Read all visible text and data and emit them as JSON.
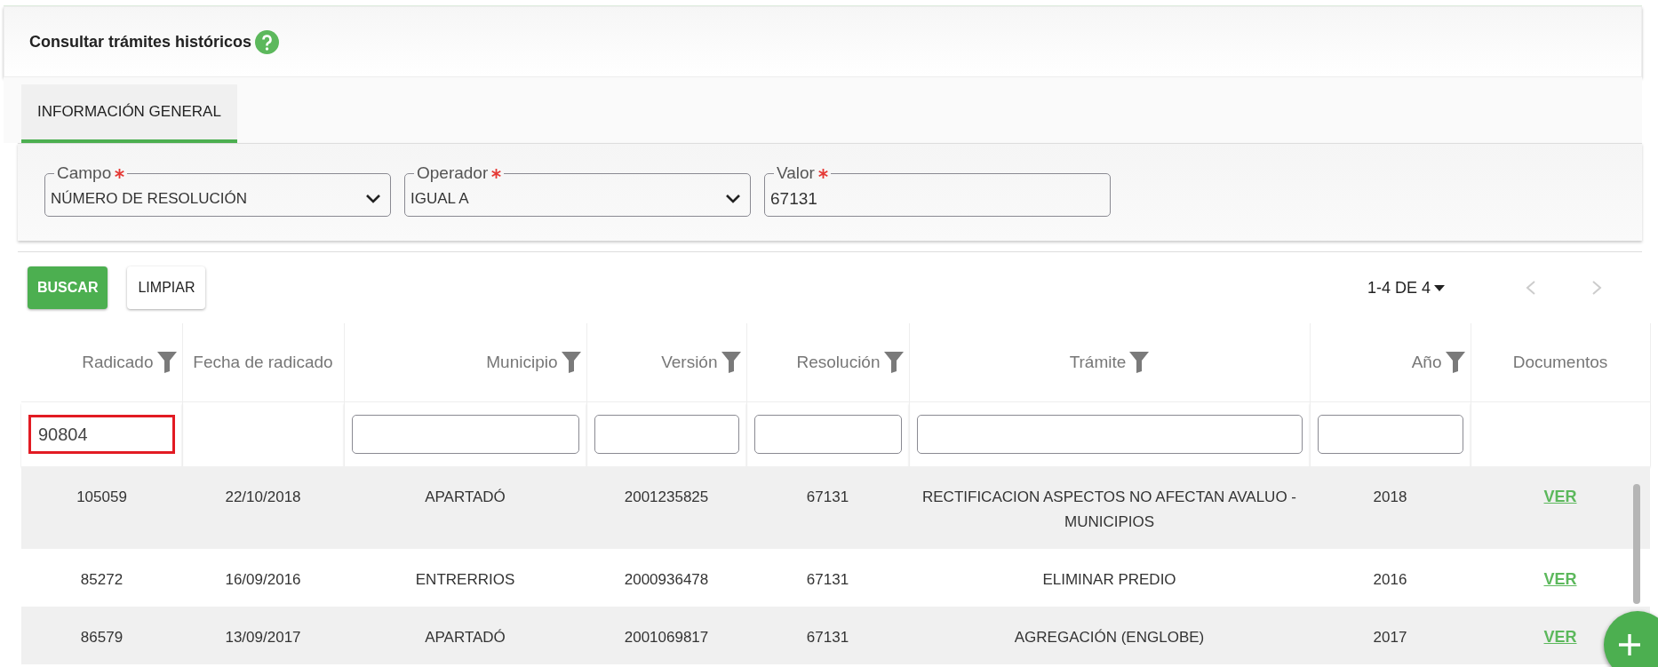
{
  "header": {
    "title": "Consultar trámites históricos"
  },
  "tabs": [
    {
      "label": "INFORMACIÓN GENERAL",
      "selected": true
    }
  ],
  "fields": [
    {
      "kind": "select",
      "label": "Campo",
      "required": true,
      "value": "NÚMERO DE RESOLUCIÓN"
    },
    {
      "kind": "select",
      "label": "Operador",
      "required": true,
      "value": "IGUAL A"
    },
    {
      "kind": "text",
      "label": "Valor",
      "required": true,
      "value": "67131"
    }
  ],
  "buttons": [
    {
      "label": "BUSCAR",
      "kind": "primary"
    },
    {
      "label": "LIMPIAR",
      "kind": "secondary"
    }
  ],
  "pagination": {
    "range": "1-4 DE 4",
    "prev_disabled": true,
    "next_disabled": true
  },
  "table": {
    "columns": [
      {
        "label": "Radicado",
        "filterable": true
      },
      {
        "label": "Fecha de radicado",
        "filterable": false
      },
      {
        "label": "Municipio",
        "filterable": true
      },
      {
        "label": "Versión",
        "filterable": true
      },
      {
        "label": "Resolución",
        "filterable": true
      },
      {
        "label": "Trámite",
        "filterable": true
      },
      {
        "label": "Año",
        "filterable": true
      },
      {
        "label": "Documentos",
        "filterable": false
      }
    ],
    "filters": [
      {
        "kind": "input",
        "value": "90804",
        "highlighted": true
      },
      {
        "kind": "none"
      },
      {
        "kind": "input",
        "highlighted": false
      },
      {
        "kind": "input",
        "highlighted": false
      },
      {
        "kind": "input",
        "highlighted": false
      },
      {
        "kind": "input",
        "highlighted": false
      },
      {
        "kind": "input",
        "highlighted": false
      },
      {
        "kind": "none"
      }
    ],
    "rows": [
      {
        "cells": [
          "105059",
          "22/10/2018",
          "APARTADÓ",
          "2001235825",
          "67131",
          "RECTIFICACION ASPECTOS NO AFECTAN AVALUO - MUNICIPIOS",
          "2018"
        ],
        "link": "VER"
      },
      {
        "cells": [
          "85272",
          "16/09/2016",
          "ENTRERRIOS",
          "2000936478",
          "67131",
          "ELIMINAR PREDIO",
          "2016"
        ],
        "link": "VER"
      },
      {
        "cells": [
          "86579",
          "13/09/2017",
          "APARTADÓ",
          "2001069817",
          "67131",
          "AGREGACIÓN (ENGLOBE)",
          "2017"
        ],
        "link": "VER"
      }
    ]
  }
}
